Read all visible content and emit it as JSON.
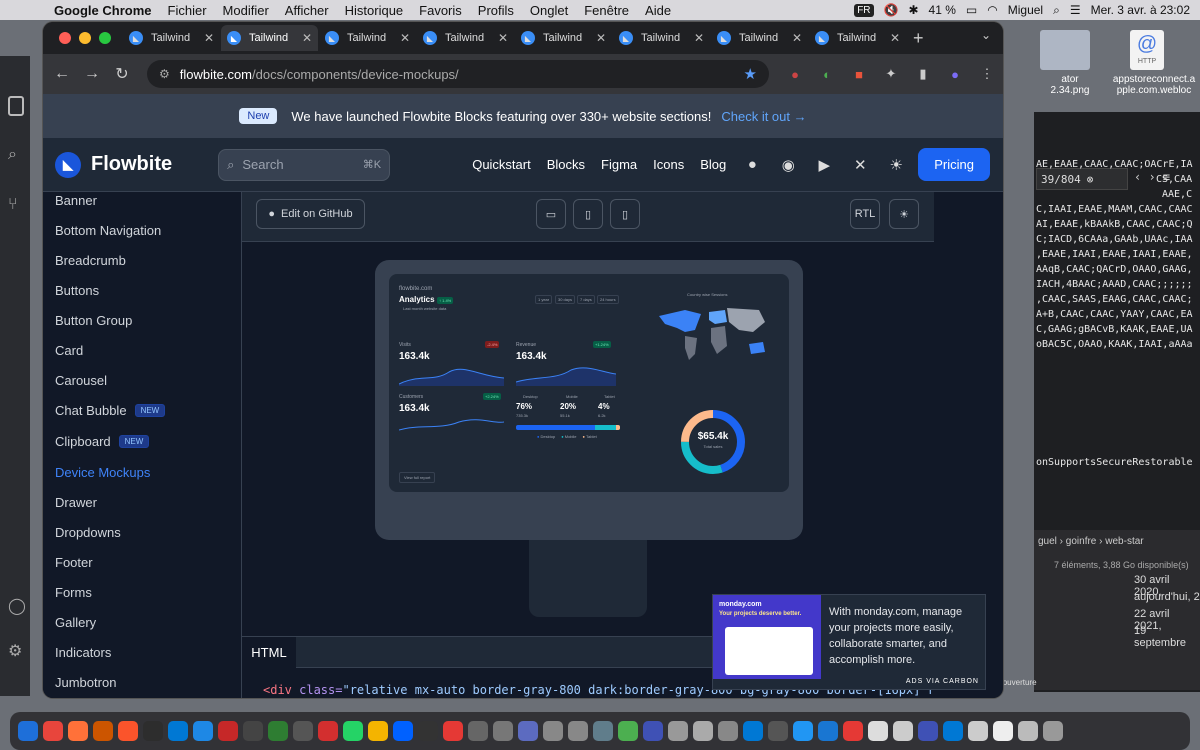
{
  "menubar": {
    "app": "Google Chrome",
    "items": [
      "Fichier",
      "Modifier",
      "Afficher",
      "Historique",
      "Favoris",
      "Profils",
      "Onglet",
      "Fenêtre",
      "Aide"
    ],
    "input_source": "FR",
    "battery": "41 %",
    "user": "Miguel",
    "clock": "Mer. 3 avr. à 23:02"
  },
  "desktop": {
    "icon1_label": "ator\n2.34.png",
    "icon2_badge": "@",
    "icon2_type": "HTTP",
    "icon2_label": "appstoreconnect.a\npple.com.webloc"
  },
  "bg_terminal": {
    "search_value": "39/804",
    "lines": [
      "AE,EAAE,CAAC,CAAC;OACrE,IA",
      "CS,CAA",
      "AAE,C",
      "C,IAAI,EAAE,MAAM,CAAC,CAAC",
      "AI,EAAE,kBAAkB,CAAC,CAAC;Q",
      "C;IACD,6CAAa,GAAb,UAAc,IAA",
      ",EAAE,IAAI,EAAE,IAAI,EAAE,",
      "AAqB,CAAC;QACrD,OAAO,GAAG,",
      "IACH,4BAAC;AAAD,CAAC;;;;;;",
      ",CAAC,SAAS,EAAG,CAAC,CAAC;",
      "A+B,CAAC,CAAC,YAAY,CAAC,EA",
      "C,GAAG;gBACvB,KAAK,EAAE,UA",
      "oBAC5C,OAAO,KAAK,IAAI,aAAa"
    ],
    "footer_line": "onSupportsSecureRestorable"
  },
  "bg_finder": {
    "path": [
      "guel",
      "goinfre",
      "web-star"
    ],
    "status": "7 éléments, 3,88 Go disponible(s)",
    "dates": [
      "30 avril 2020,",
      "aujourd'hui, 2",
      "22 avril 2021,",
      "19 septembre"
    ],
    "caption": "Valeur d'ouverture"
  },
  "browser": {
    "tabs": [
      {
        "label": "Tailwind",
        "active": false
      },
      {
        "label": "Tailwind",
        "active": true
      },
      {
        "label": "Tailwind",
        "active": false
      },
      {
        "label": "Tailwind",
        "active": false
      },
      {
        "label": "Tailwind",
        "active": false
      },
      {
        "label": "Tailwind",
        "active": false
      },
      {
        "label": "Tailwind",
        "active": false
      },
      {
        "label": "Tailwind",
        "active": false
      }
    ],
    "url_host": "flowbite.com",
    "url_path": "/docs/components/device-mockups/"
  },
  "page": {
    "banner": {
      "badge": "New",
      "text": "We have launched Flowbite Blocks featuring over 330+ website sections!",
      "link": "Check it out →"
    },
    "header": {
      "logo": "Flowbite",
      "search_placeholder": "Search",
      "search_kbd": "⌘K",
      "nav": [
        "Quickstart",
        "Blocks",
        "Figma",
        "Icons",
        "Blog"
      ],
      "pricing": "Pricing"
    },
    "sidebar": [
      {
        "label": "Banner"
      },
      {
        "label": "Bottom Navigation"
      },
      {
        "label": "Breadcrumb"
      },
      {
        "label": "Buttons"
      },
      {
        "label": "Button Group"
      },
      {
        "label": "Card"
      },
      {
        "label": "Carousel"
      },
      {
        "label": "Chat Bubble",
        "badge": "NEW"
      },
      {
        "label": "Clipboard",
        "badge": "NEW"
      },
      {
        "label": "Device Mockups",
        "active": true
      },
      {
        "label": "Drawer"
      },
      {
        "label": "Dropdowns"
      },
      {
        "label": "Footer"
      },
      {
        "label": "Forms"
      },
      {
        "label": "Gallery"
      },
      {
        "label": "Indicators"
      },
      {
        "label": "Jumbotron"
      }
    ],
    "demo": {
      "edit_github": "Edit on GitHub",
      "rtl": "RTL",
      "dashboard": {
        "site": "flowbite.com",
        "title": "Analytics",
        "title_badge": "↑ 1.4%",
        "subtitle": "Last month website data",
        "ranges": [
          "1 year",
          "30 days",
          "7 days",
          "24 hours"
        ],
        "map_title": "Country wise Sessions",
        "visits_label": "Visits",
        "visits_value": "163.4k",
        "visits_change": "-2.4%",
        "revenue_label": "Revenue",
        "revenue_value": "163.4k",
        "revenue_change": "+1.24%",
        "customers_label": "Customers",
        "customers_value": "163.4k",
        "customers_change": "+2.24%",
        "devices": [
          {
            "label": "Desktop",
            "pct": "76%",
            "sub": "735.3k"
          },
          {
            "label": "Mobile",
            "pct": "20%",
            "sub": "55.1k"
          },
          {
            "label": "Tablet",
            "pct": "4%",
            "sub": "6.2k"
          }
        ],
        "donut_value": "$65.4k",
        "donut_label": "Total sales",
        "view_report": "View full report"
      }
    },
    "code_tab": "HTML",
    "code": {
      "open": "<div ",
      "attr": "class=",
      "value": "\"relative mx-auto border-gray-800 dark:border-gray-800 bg-gray-800 border-[16px] rour"
    },
    "ad": {
      "brand": "monday.com",
      "headline": "Your projects deserve better.",
      "text": "With monday.com, manage your projects more easily, collaborate smarter, and accomplish more.",
      "footer": "ADS VIA CARBON"
    }
  }
}
